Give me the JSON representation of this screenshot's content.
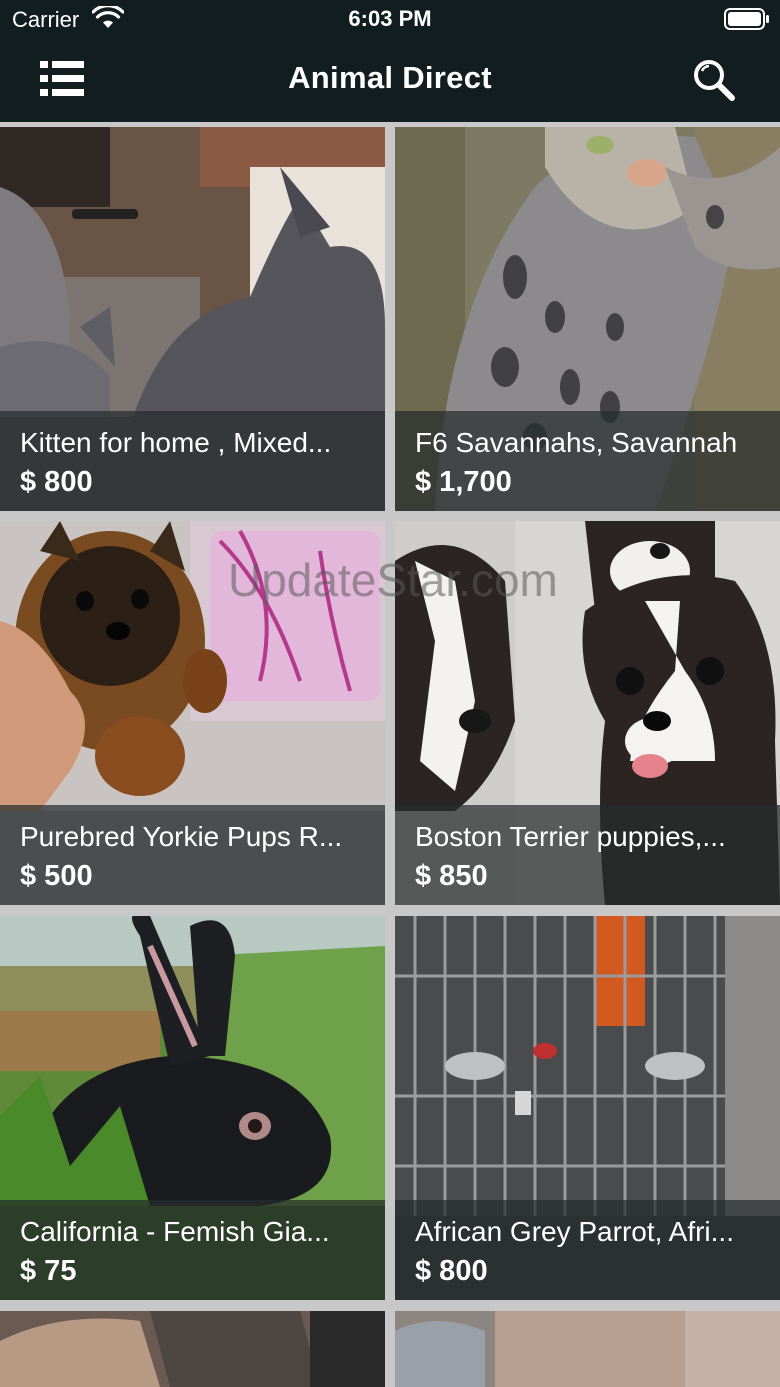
{
  "status_bar": {
    "carrier": "Carrier",
    "time": "6:03 PM",
    "wifi_icon": "wifi-icon",
    "battery_icon": "battery-icon"
  },
  "nav": {
    "title": "Animal Direct",
    "menu_icon": "list-menu-icon",
    "search_icon": "search-icon"
  },
  "listings": [
    {
      "title": "Kitten for home , Mixed...",
      "price": "$ 800",
      "image": "sphynx-kittens-photo"
    },
    {
      "title": "F6 Savannahs, Savannah",
      "price": "$ 1,700",
      "image": "savannah-kitten-photo"
    },
    {
      "title": "Purebred Yorkie Pups R...",
      "price": "$ 500",
      "image": "yorkie-puppy-photo"
    },
    {
      "title": "Boston Terrier puppies,...",
      "price": "$ 850",
      "image": "boston-terrier-puppies-photo"
    },
    {
      "title": "California - Femish Gia...",
      "price": "$ 75",
      "image": "black-rabbit-photo"
    },
    {
      "title": "African Grey Parrot, Afri...",
      "price": "$ 800",
      "image": "parrot-cage-photo"
    }
  ],
  "watermark": "UpdateStar.com",
  "colors": {
    "header_bg": "#121d1f",
    "grid_bg": "#c8c8c8",
    "overlay": "#262c2c"
  }
}
